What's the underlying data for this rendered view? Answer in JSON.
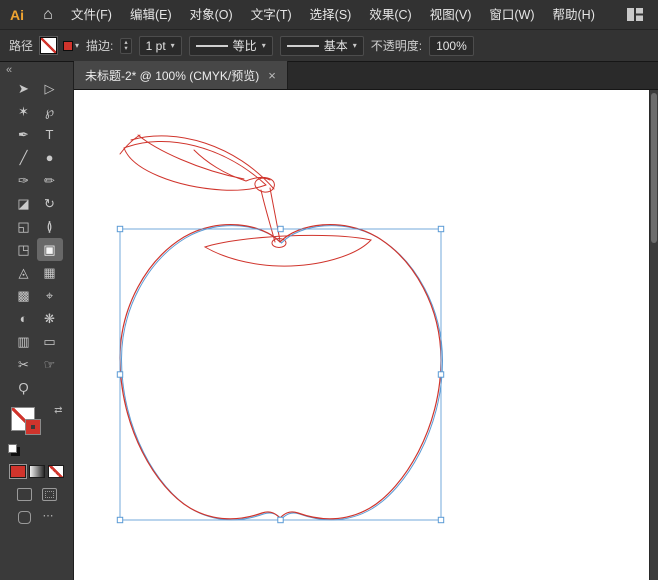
{
  "colors": {
    "accent-red": "#d0342c",
    "selection-blue": "#5b9bd5",
    "logo-amber": "#f0a431"
  },
  "menubar": {
    "logo": "Ai",
    "items": [
      {
        "id": "file",
        "label": "文件(F)"
      },
      {
        "id": "edit",
        "label": "编辑(E)"
      },
      {
        "id": "object",
        "label": "对象(O)"
      },
      {
        "id": "type",
        "label": "文字(T)"
      },
      {
        "id": "select",
        "label": "选择(S)"
      },
      {
        "id": "effect",
        "label": "效果(C)"
      },
      {
        "id": "view",
        "label": "视图(V)"
      },
      {
        "id": "window",
        "label": "窗口(W)"
      },
      {
        "id": "help",
        "label": "帮助(H)"
      }
    ]
  },
  "control_bar": {
    "selection_type": "路径",
    "stroke_label": "描边:",
    "stroke_weight": "1 pt",
    "width_profile": "等比",
    "brush_definition": "基本",
    "opacity_label": "不透明度:",
    "opacity_value": "100%"
  },
  "document_tab": {
    "title": "未标题-2* @ 100% (CMYK/预览)",
    "close_glyph": "×"
  },
  "icons": {
    "home": "⌂",
    "collapse": "«",
    "chevron_down": "▾",
    "stepper_up": "▴",
    "stepper_down": "▾",
    "swap": "⇄",
    "overflow": "⋯"
  },
  "tools": {
    "items": [
      {
        "name": "selection-tool",
        "glyph": "➤"
      },
      {
        "name": "direct-selection-tool",
        "glyph": "▷"
      },
      {
        "name": "magic-wand-tool",
        "glyph": "✶"
      },
      {
        "name": "lasso-tool",
        "glyph": "℘"
      },
      {
        "name": "pen-tool",
        "glyph": "✒"
      },
      {
        "name": "type-tool",
        "glyph": "T"
      },
      {
        "name": "line-segment-tool",
        "glyph": "╱"
      },
      {
        "name": "ellipse-tool",
        "glyph": "●"
      },
      {
        "name": "paintbrush-tool",
        "glyph": "✑"
      },
      {
        "name": "pencil-tool",
        "glyph": "✏"
      },
      {
        "name": "eraser-tool",
        "glyph": "◪"
      },
      {
        "name": "rotate-tool",
        "glyph": "↻"
      },
      {
        "name": "scale-tool",
        "glyph": "◱"
      },
      {
        "name": "width-tool",
        "glyph": "≬"
      },
      {
        "name": "free-transform-tool",
        "glyph": "◳"
      },
      {
        "name": "shape-builder-tool",
        "glyph": "▣",
        "active": true
      },
      {
        "name": "perspective-grid-tool",
        "glyph": "◬"
      },
      {
        "name": "mesh-tool",
        "glyph": "▦"
      },
      {
        "name": "gradient-tool",
        "glyph": "▩"
      },
      {
        "name": "eyedropper-tool",
        "glyph": "⌖"
      },
      {
        "name": "blend-tool",
        "glyph": "◐"
      },
      {
        "name": "symbol-sprayer-tool",
        "glyph": "❋"
      },
      {
        "name": "column-graph-tool",
        "glyph": "▥"
      },
      {
        "name": "artboard-tool",
        "glyph": "▭"
      },
      {
        "name": "slice-tool",
        "glyph": "✂"
      },
      {
        "name": "hand-tool",
        "glyph": "☞"
      },
      {
        "name": "zoom-tool",
        "glyph": "Ϙ"
      }
    ]
  }
}
